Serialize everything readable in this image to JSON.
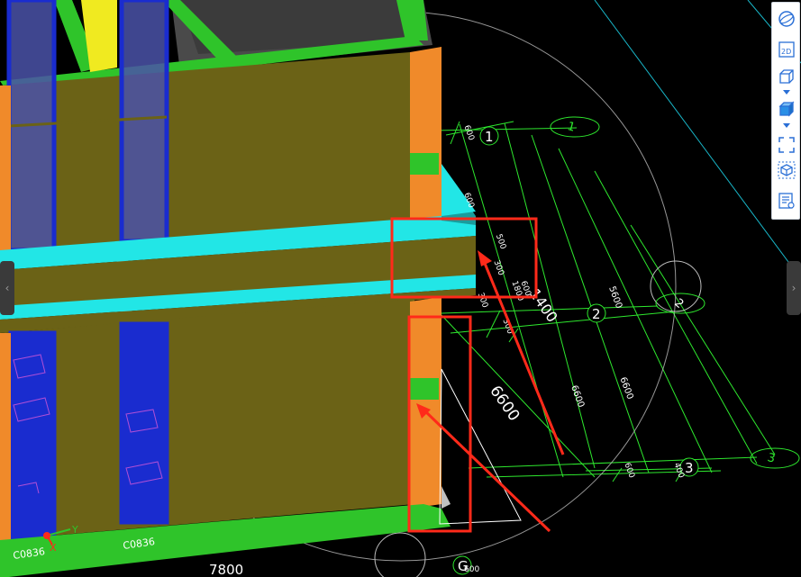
{
  "colors": {
    "background": "#000000",
    "wall_olive": "#6b6216",
    "column_orange": "#f08a2a",
    "slab_cyan": "#22e6e6",
    "floor_green": "#2fc42a",
    "window_blue": "#1a2ccf",
    "grid_green": "#2ee82e",
    "axis_cyan": "#19b7c9",
    "annotation_red": "#ff2a1a"
  },
  "axis_bubbles": {
    "b1": "1",
    "b2": "2",
    "b3": "3",
    "bg": "G"
  },
  "axis_labels": {
    "l1": "1",
    "l2": "2",
    "l3": "3",
    "lg": "G"
  },
  "dimensions": {
    "d_1400": "1400",
    "d_6600": "6600",
    "d_7800": "7800",
    "d_5600": "5600",
    "d_6600b": "6600",
    "d_6600c": "6600",
    "d_600a": "600",
    "d_600b": "600",
    "d_1800": "1800",
    "d_300a": "300",
    "d_300b": "300",
    "d_300c": "300",
    "d_500": "500",
    "d_600c": "600",
    "d_600d": "600",
    "d_400": "400",
    "d_600e": "600"
  },
  "component_labels": {
    "window_a": "C0836",
    "window_b": "C0836"
  },
  "axes_gizmo": {
    "x": "X",
    "y": "Y"
  },
  "toolbar": {
    "icons": [
      "sphere-view-icon",
      "2d-view-icon",
      "3d-box-icon",
      "solid-box-icon",
      "frame-select-icon",
      "cube-select-icon",
      "properties-list-icon"
    ],
    "label_2d": "2D"
  },
  "side_tabs": {
    "left": "‹",
    "right": "›"
  }
}
